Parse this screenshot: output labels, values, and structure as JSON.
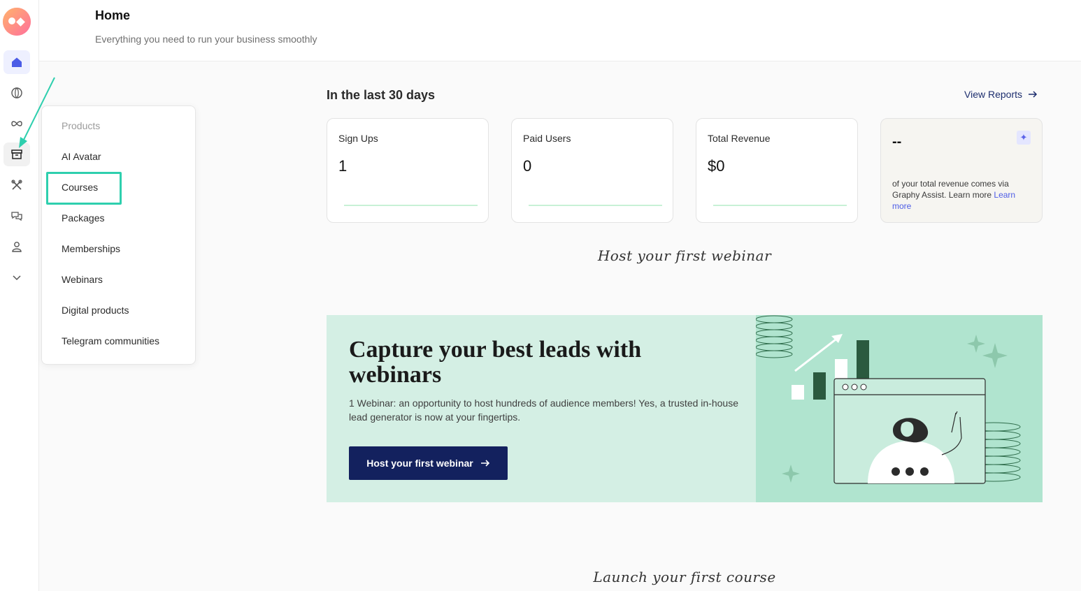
{
  "header": {
    "title": "Home",
    "subtitle": "Everything you need to run your business smoothly"
  },
  "rail": {
    "items": [
      "home-icon",
      "globe-icon",
      "infinity-icon",
      "archive-icon",
      "tools-icon",
      "chat-icon",
      "user-icon",
      "chevron-down-icon"
    ],
    "active": "home-icon",
    "hovered": "archive-icon"
  },
  "menu": {
    "heading": "Products",
    "items": [
      "AI Avatar",
      "Courses",
      "Packages",
      "Memberships",
      "Webinars",
      "Digital products",
      "Telegram communities"
    ],
    "highlighted": "Courses"
  },
  "stats": {
    "section_title": "In the last 30 days",
    "view_reports": "View Reports",
    "cards": [
      {
        "label": "Sign Ups",
        "value": "1"
      },
      {
        "label": "Paid Users",
        "value": "0"
      },
      {
        "label": "Total Revenue",
        "value": "$0"
      }
    ],
    "assist": {
      "value": "--",
      "text": "of your total revenue comes via Graphy Assist. Learn more",
      "link": "Learn more"
    }
  },
  "webinar": {
    "script_heading": "Host your first webinar",
    "title": "Capture your best leads with webinars",
    "description": "1 Webinar: an opportunity to host hundreds of audience members! Yes, a trusted in-house lead generator is now at your fingertips.",
    "cta": "Host your first webinar"
  },
  "course": {
    "script_heading": "Launch your first course"
  },
  "colors": {
    "accent": "#2ecfae",
    "primary": "#13215e",
    "banner_bg": "#d4efe4",
    "banner_art_bg": "#b0e4cf",
    "link": "#4e5de6"
  }
}
